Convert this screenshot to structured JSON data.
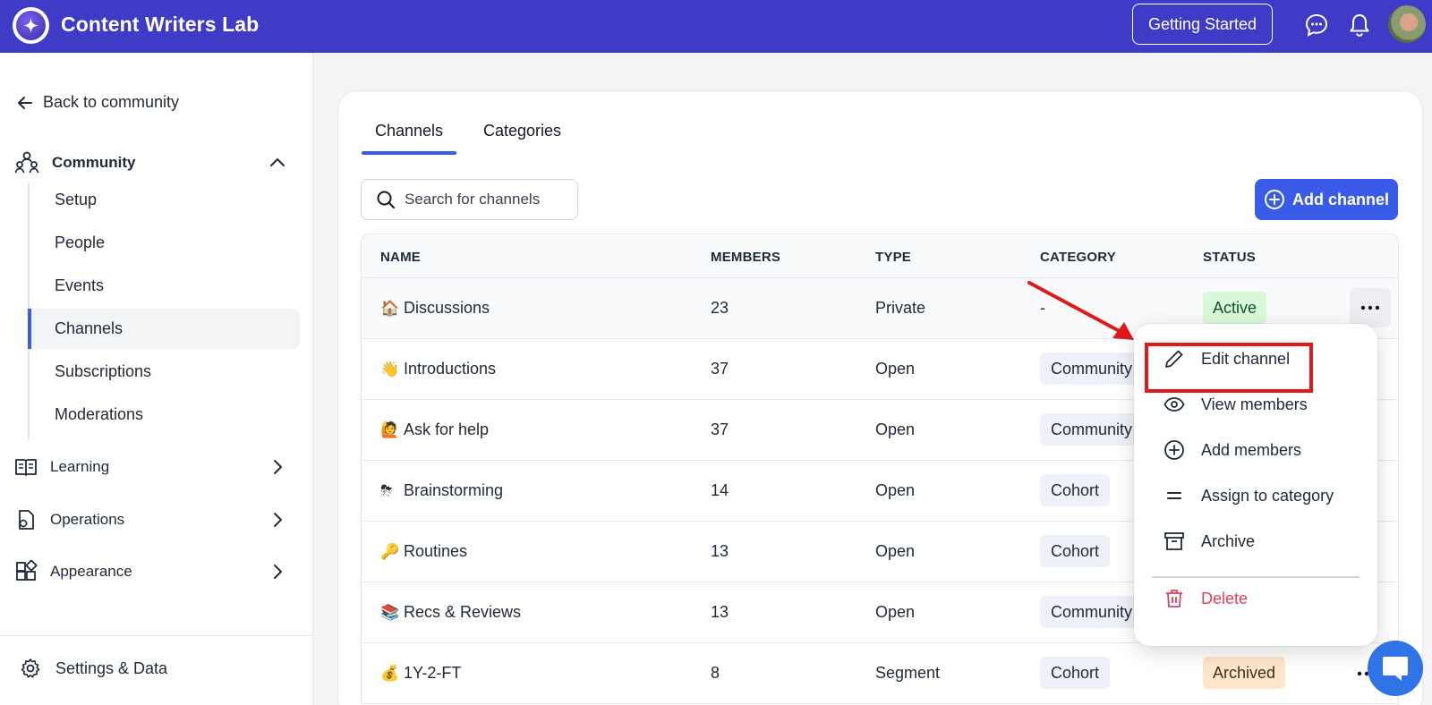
{
  "header": {
    "app_title": "Content Writers Lab",
    "getting_started_label": "Getting Started",
    "brand_color": "#3f3bc6"
  },
  "sidebar": {
    "back_label": "Back to community",
    "community_label": "Community",
    "sub_items": [
      {
        "label": "Setup"
      },
      {
        "label": "People"
      },
      {
        "label": "Events"
      },
      {
        "label": "Channels",
        "active": true
      },
      {
        "label": "Subscriptions"
      },
      {
        "label": "Moderations"
      }
    ],
    "sections": [
      {
        "label": "Learning",
        "icon": "book-icon"
      },
      {
        "label": "Operations",
        "icon": "operations-icon"
      },
      {
        "label": "Appearance",
        "icon": "appearance-icon"
      }
    ],
    "settings_label": "Settings & Data"
  },
  "main": {
    "tabs": [
      {
        "label": "Channels",
        "active": true
      },
      {
        "label": "Categories",
        "active": false
      }
    ],
    "search_placeholder": "Search for channels",
    "add_channel_label": "Add channel",
    "accent_color": "#3a5be8",
    "table": {
      "headers": [
        "NAME",
        "MEMBERS",
        "TYPE",
        "CATEGORY",
        "STATUS"
      ],
      "rows": [
        {
          "emoji": "🏠",
          "name": "Discussions",
          "members": "23",
          "type": "Private",
          "category": "-",
          "status": "Active"
        },
        {
          "emoji": "👋",
          "name": "Introductions",
          "members": "37",
          "type": "Open",
          "category": "Community",
          "status": ""
        },
        {
          "emoji": "🙋",
          "name": "Ask for help",
          "members": "37",
          "type": "Open",
          "category": "Community",
          "status": ""
        },
        {
          "emoji": "⛈",
          "name": "Brainstorming",
          "members": "14",
          "type": "Open",
          "category": "Cohort",
          "status": ""
        },
        {
          "emoji": "🔑",
          "name": "Routines",
          "members": "13",
          "type": "Open",
          "category": "Cohort",
          "status": ""
        },
        {
          "emoji": "📚",
          "name": "Recs & Reviews",
          "members": "13",
          "type": "Open",
          "category": "Community",
          "status": ""
        },
        {
          "emoji": "💰",
          "name": "1Y-2-FT",
          "members": "8",
          "type": "Segment",
          "category": "Cohort",
          "status": "Archived"
        }
      ]
    }
  },
  "context_menu": {
    "items": [
      {
        "label": "Edit channel",
        "icon": "pencil-icon"
      },
      {
        "label": "View members",
        "icon": "eye-icon"
      },
      {
        "label": "Add members",
        "icon": "plus-circle-icon"
      },
      {
        "label": "Assign to category",
        "icon": "equals-icon"
      },
      {
        "label": "Archive",
        "icon": "archive-box-icon"
      },
      {
        "label": "Delete",
        "icon": "trash-icon",
        "danger": true
      }
    ],
    "danger_color": "#e0405a",
    "annotation_color": "#e01919"
  }
}
